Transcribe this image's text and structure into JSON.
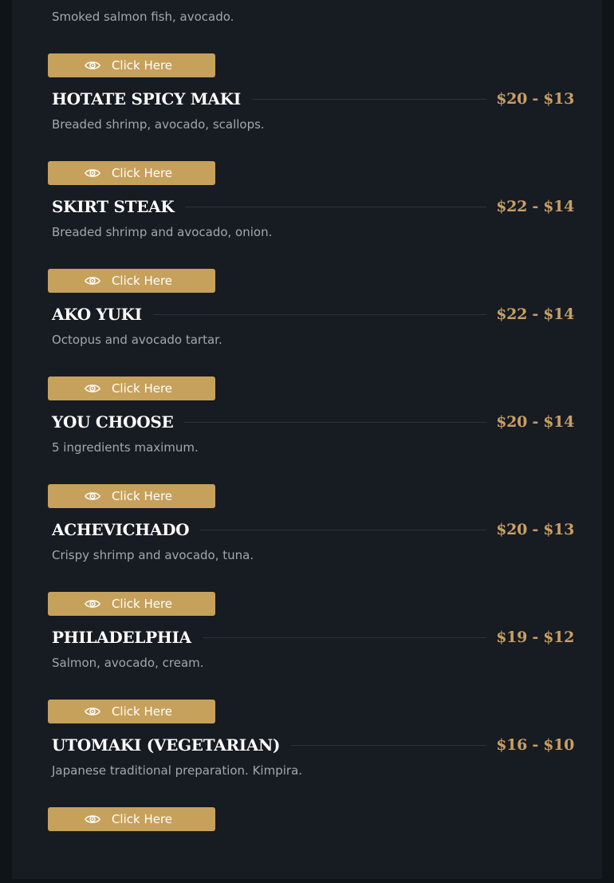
{
  "intro_desc": "Smoked salmon fish, avocado.",
  "cta_label": "Click Here",
  "cta_icon": "eye-icon",
  "colors": {
    "background": "#171b22",
    "accent": "#c6a15b",
    "price": "#c7a063",
    "title": "#ffffff",
    "description": "#a3a7ad"
  },
  "items": [
    {
      "title": "HOTATE SPICY MAKI",
      "price": "$20 - $13",
      "desc": "Breaded shrimp, avocado, scallops."
    },
    {
      "title": "SKIRT STEAK",
      "price": "$22 - $14",
      "desc": "Breaded shrimp and avocado, onion."
    },
    {
      "title": "AKO YUKI",
      "price": "$22 - $14",
      "desc": "Octopus and avocado tartar."
    },
    {
      "title": "YOU CHOOSE",
      "price": "$20 - $14",
      "desc": "5 ingredients maximum."
    },
    {
      "title": "ACHEVICHADO",
      "price": "$20 - $13",
      "desc": "Crispy shrimp and avocado, tuna."
    },
    {
      "title": "PHILADELPHIA",
      "price": "$19 - $12",
      "desc": "Salmon, avocado, cream."
    },
    {
      "title": "UTOMAKI (VEGETARIAN)",
      "price": "$16 - $10",
      "desc": "Japanese traditional preparation. Kimpira."
    }
  ]
}
